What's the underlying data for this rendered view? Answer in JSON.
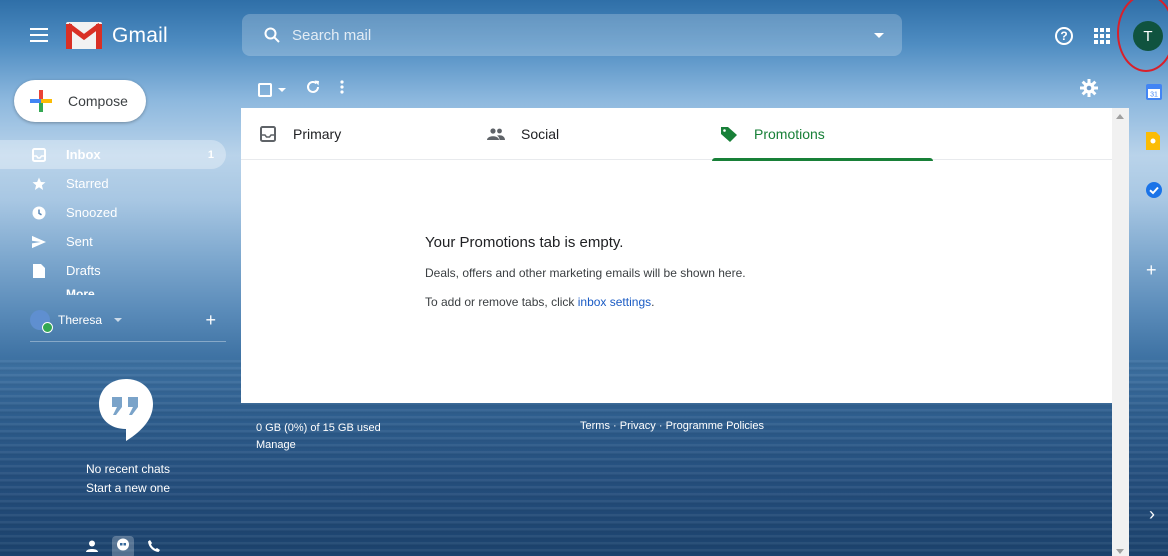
{
  "app": {
    "title": "Gmail"
  },
  "search": {
    "placeholder": "Search mail"
  },
  "header": {
    "help_symbol": "?",
    "avatar_letter": "T"
  },
  "compose": {
    "label": "Compose"
  },
  "nav": {
    "items": [
      {
        "label": "Inbox",
        "count": "1",
        "icon": "inbox-icon"
      },
      {
        "label": "Starred",
        "icon": "star-icon"
      },
      {
        "label": "Snoozed",
        "icon": "clock-icon"
      },
      {
        "label": "Sent",
        "icon": "send-icon"
      },
      {
        "label": "Drafts",
        "icon": "draft-icon"
      }
    ],
    "more_label": "More"
  },
  "hangouts": {
    "user_name": "Theresa",
    "add_symbol": "+",
    "empty_title": "No recent chats",
    "empty_action": "Start a new one"
  },
  "tabs": [
    {
      "label": "Primary",
      "icon": "inbox-icon"
    },
    {
      "label": "Social",
      "icon": "people-icon"
    },
    {
      "label": "Promotions",
      "icon": "tag-icon",
      "selected": true
    }
  ],
  "empty_state": {
    "title": "Your Promotions tab is empty.",
    "line1": "Deals, offers and other marketing emails will be shown here.",
    "line2_prefix": "To add or remove tabs, click ",
    "line2_link": "inbox settings",
    "line2_suffix": "."
  },
  "footer": {
    "storage": "0 GB (0%) of 15 GB used",
    "manage": "Manage",
    "terms": "Terms",
    "privacy": "Privacy",
    "policies": "Programme Policies",
    "separator": " · "
  },
  "side_panel": {
    "calendar_day": "31",
    "add_symbol": "+",
    "chevron": "›"
  },
  "colors": {
    "accent_green": "#188038",
    "avatar_bg": "#10533f",
    "link_blue": "#1a5bc4",
    "highlight_red": "#d8202b"
  }
}
